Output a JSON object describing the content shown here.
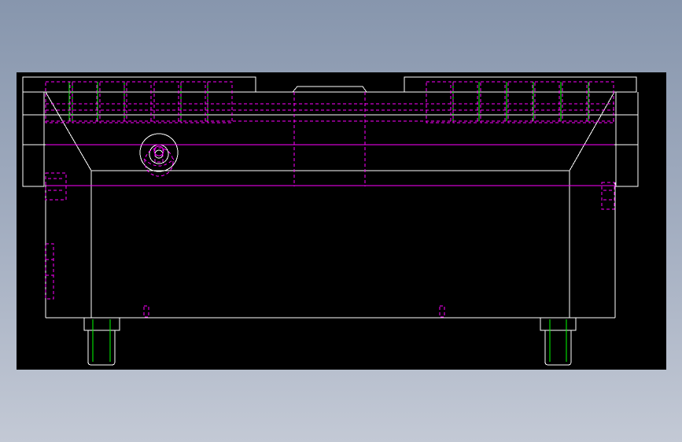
{
  "drawing": {
    "background": "#000000",
    "colors": {
      "outline": "#ffffff",
      "hidden": "#ff00ff",
      "thread": "#00ff00"
    }
  }
}
